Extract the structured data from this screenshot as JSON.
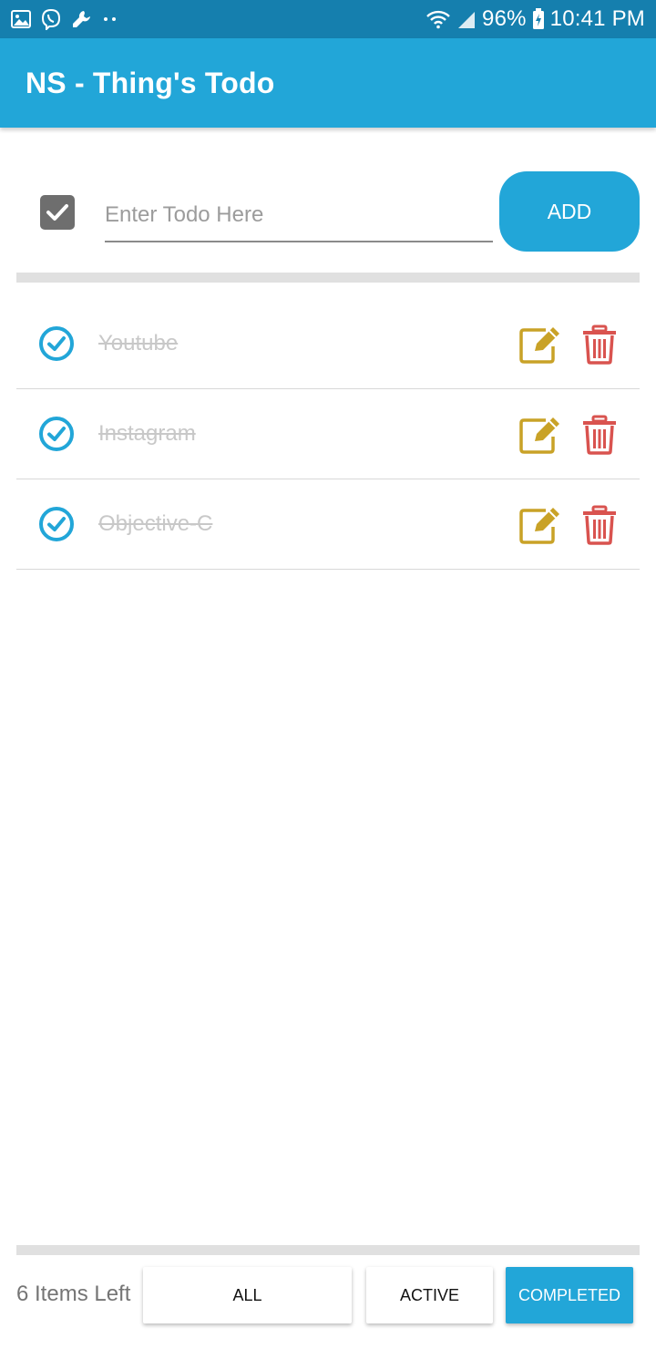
{
  "status_bar": {
    "battery": "96%",
    "time": "10:41 PM",
    "icons_left": [
      "image-icon",
      "viber-icon",
      "wrench-icon",
      "more-dots-icon"
    ],
    "icons_right": [
      "wifi-icon",
      "signal-icon",
      "battery-charging-icon"
    ]
  },
  "app_bar": {
    "title": "NS - Thing's Todo"
  },
  "new_todo": {
    "placeholder": "Enter Todo Here",
    "value": "",
    "add_label": "ADD"
  },
  "todos": [
    {
      "text": "Youtube",
      "completed": true
    },
    {
      "text": "Instagram",
      "completed": true
    },
    {
      "text": "Objective-C",
      "completed": true
    }
  ],
  "footer": {
    "items_left": "6 Items Left",
    "filters": {
      "all": "ALL",
      "active": "ACTIVE",
      "completed": "COMPLETED"
    },
    "selected_filter": "COMPLETED"
  },
  "colors": {
    "status_bar": "#157fae",
    "primary": "#22a6d8",
    "edit": "#c9a227",
    "delete": "#d9534f",
    "completed_text": "#c8c8c8"
  }
}
